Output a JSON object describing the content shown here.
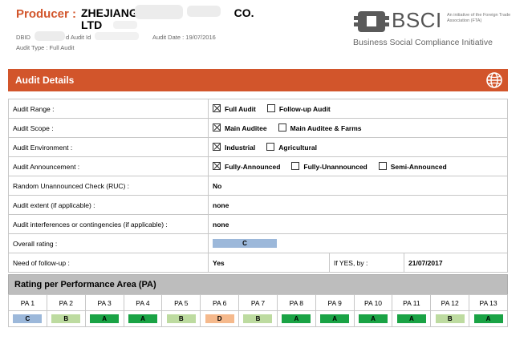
{
  "header": {
    "producer_label": "Producer :",
    "producer_name_line1": "ZHEJIANG",
    "producer_name_mid": "CO.",
    "producer_name_line2": "LTD",
    "dbid_label": "DBID",
    "audit_id_label": "d Audit Id",
    "audit_date": "Audit Date : 19/07/2016",
    "audit_type": "Audit Type : Full Audit"
  },
  "logo": {
    "name": "BSCI",
    "small_text": "An initiative of the Foreign Trade Association (FTA)",
    "tagline": "Business Social Compliance Initiative"
  },
  "section": {
    "title": "Audit Details",
    "icon": "globe-icon"
  },
  "details": [
    {
      "label": "Audit Range :",
      "options": [
        {
          "text": "Full Audit",
          "checked": true
        },
        {
          "text": "Follow-up Audit",
          "checked": false
        }
      ]
    },
    {
      "label": "Audit Scope :",
      "options": [
        {
          "text": "Main Auditee",
          "checked": true
        },
        {
          "text": "Main Auditee & Farms",
          "checked": false
        }
      ]
    },
    {
      "label": "Audit Environment :",
      "options": [
        {
          "text": "Industrial",
          "checked": true
        },
        {
          "text": "Agricultural",
          "checked": false
        }
      ]
    },
    {
      "label": "Audit Announcement :",
      "options": [
        {
          "text": "Fully-Announced",
          "checked": true
        },
        {
          "text": "Fully-Unannounced",
          "checked": false
        },
        {
          "text": "Semi-Announced",
          "checked": false
        }
      ]
    },
    {
      "label": "Random Unannounced Check (RUC) :",
      "value": "No"
    },
    {
      "label": "Audit extent (if applicable) :",
      "value": "none"
    },
    {
      "label": "Audit interferences or contingencies (if applicable) :",
      "value": "none"
    },
    {
      "label": "Overall rating :",
      "rating": "C"
    },
    {
      "label": "Need of follow-up :",
      "value": "Yes",
      "if_yes_label": "If YES, by :",
      "if_yes_value": "21/07/2017"
    }
  ],
  "pa": {
    "title": "Rating per Performance Area (PA)",
    "areas": [
      "PA 1",
      "PA 2",
      "PA 3",
      "PA 4",
      "PA 5",
      "PA 6",
      "PA 7",
      "PA 8",
      "PA 9",
      "PA 10",
      "PA 11",
      "PA 12",
      "PA 13"
    ],
    "ratings": [
      "C",
      "B",
      "A",
      "A",
      "B",
      "D",
      "B",
      "A",
      "A",
      "A",
      "A",
      "B",
      "A"
    ]
  },
  "colors": {
    "accent": "#d2552b",
    "rating_A": "#1aa345",
    "rating_B": "#bddba0",
    "rating_C": "#9cb8da",
    "rating_D": "#f5b98c"
  }
}
